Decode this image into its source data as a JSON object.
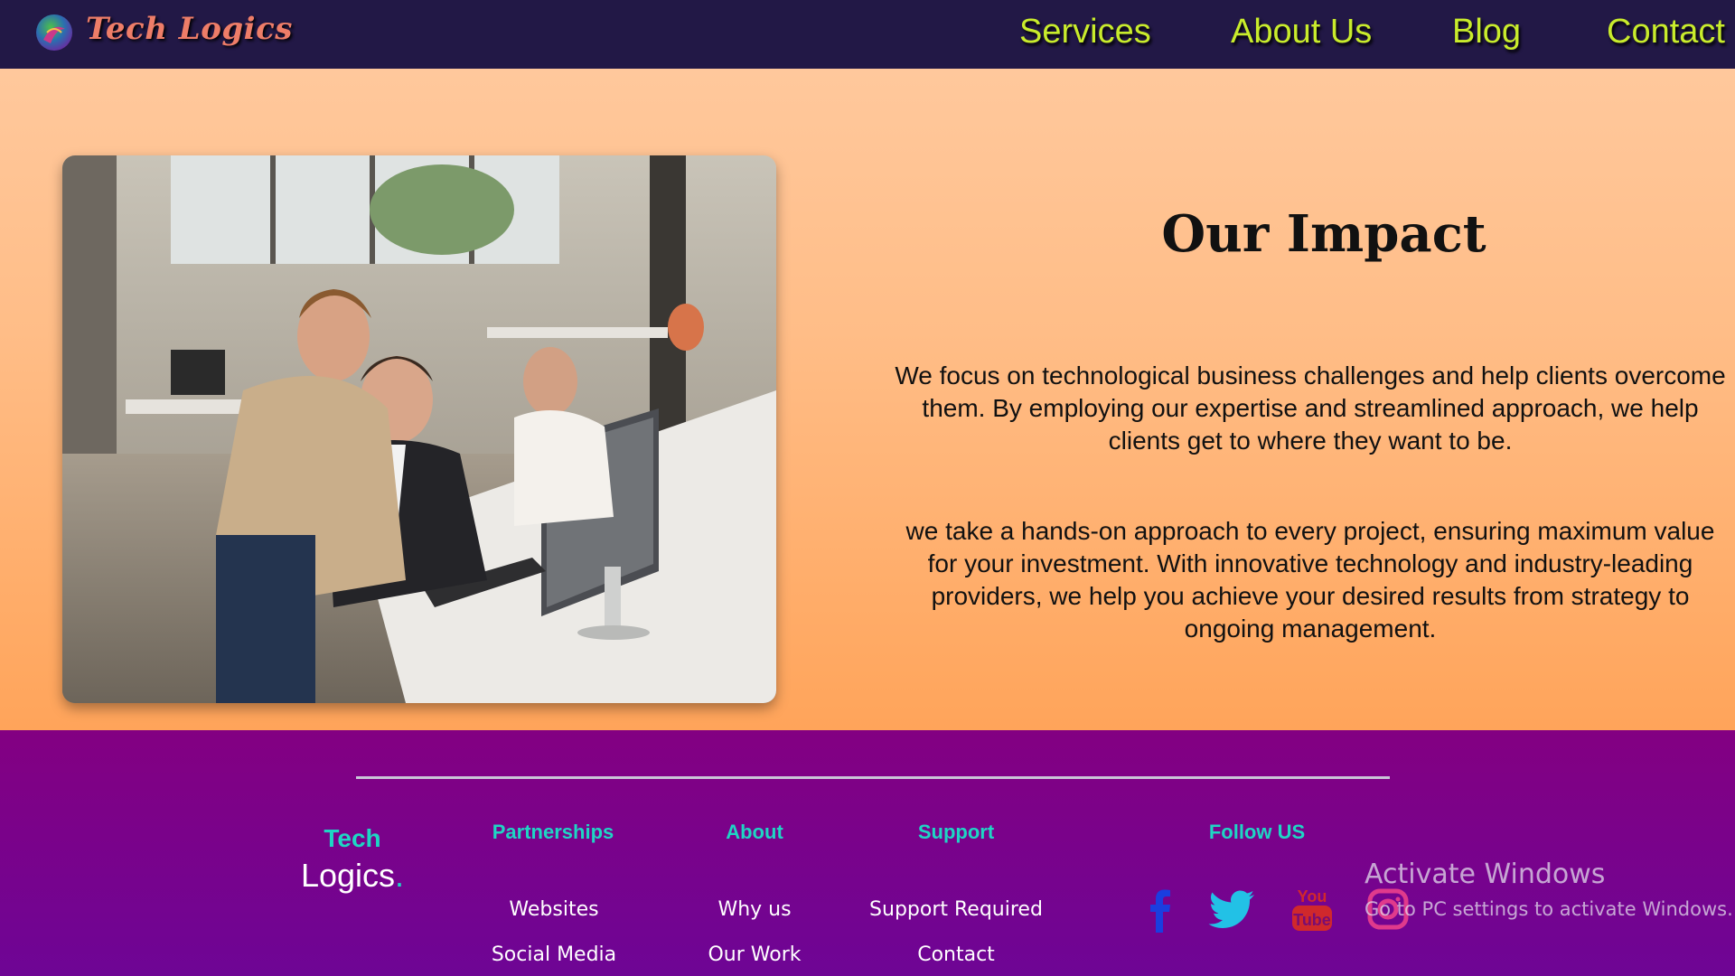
{
  "brand": {
    "name": "Tech Logics",
    "icon": "logo-globe-icon"
  },
  "nav": {
    "items": [
      {
        "label": "Services"
      },
      {
        "label": "About Us"
      },
      {
        "label": "Blog"
      },
      {
        "label": "Contact"
      }
    ]
  },
  "hero": {
    "heading": "Our Impact",
    "paragraph_1": "We focus on technological business challenges and help clients overcome them. By employing our expertise and streamlined approach, we help clients get to where they want to be.",
    "paragraph_2": "we take a hands-on approach to every project, ensuring maximum value for your investment. With innovative technology and industry-leading providers, we help you achieve your desired results from strategy to ongoing management."
  },
  "footer": {
    "brand_top": "Tech",
    "brand_bottom": "Logics",
    "brand_dot": ".",
    "columns": [
      {
        "heading": "Partnerships",
        "links": [
          "Websites",
          "Social Media"
        ]
      },
      {
        "heading": "About",
        "links": [
          "Why us",
          "Our Work"
        ]
      },
      {
        "heading": "Support",
        "links": [
          "Support Required",
          "Contact"
        ]
      },
      {
        "heading": "Follow US",
        "links": []
      }
    ],
    "social": [
      "facebook-icon",
      "twitter-icon",
      "youtube-icon",
      "instagram-icon"
    ]
  },
  "watermark": {
    "title": "Activate Windows",
    "subtitle": "Go to PC settings to activate Windows."
  },
  "colors": {
    "navbar_bg": "#221846",
    "nav_link": "#c9ec2c",
    "brand_text": "#ee7d68",
    "hero_gradient_top": "#ffc89c",
    "hero_gradient_bottom": "#ffa45a",
    "footer_bg": "#830082",
    "footer_accent": "#1ed6c4"
  }
}
